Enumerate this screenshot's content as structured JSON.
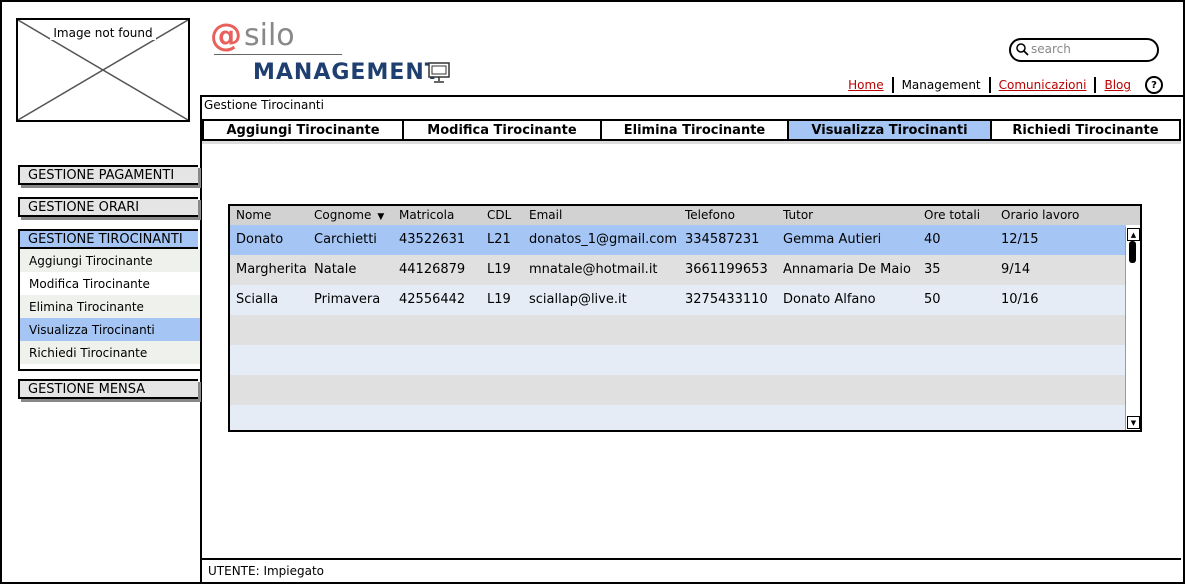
{
  "image_placeholder": {
    "label": "Image not found"
  },
  "logo": {
    "at": "@",
    "name": "silo",
    "subtitle": "MANAGEMENT"
  },
  "search": {
    "placeholder": "search"
  },
  "topnav": {
    "home": "Home",
    "management": "Management",
    "comunicazioni": "Comunicazioni",
    "blog": "Blog",
    "help": "?"
  },
  "breadcrumb": "Gestione Tirocinanti",
  "tabs": [
    "Aggiungi Tirocinante",
    "Modifica Tirocinante",
    "Elimina Tirocinante",
    "Visualizza Tirocinanti",
    "Richiedi Tirocinante"
  ],
  "active_tab": "Visualizza Tirocinanti",
  "sidebar": {
    "pagamenti": "GESTIONE PAGAMENTI",
    "orari": "GESTIONE ORARI",
    "tirocinanti": "GESTIONE TIROCINANTI",
    "items": [
      "Aggiungi Tirocinante",
      "Modifica Tirocinante",
      "Elimina Tirocinante",
      "Visualizza Tirocinanti",
      "Richiedi Tirocinante"
    ],
    "mensa": "GESTIONE MENSA"
  },
  "table": {
    "columns": [
      "Nome",
      "Cognome",
      "Matricola",
      "CDL",
      "Email",
      "Telefono",
      "Tutor",
      "Ore totali",
      "Orario lavoro"
    ],
    "sort_icon": "▼",
    "rows": [
      [
        "Donato",
        "Carchietti",
        "43522631",
        "L21",
        "donatos_1@gmail.com",
        "334587231",
        "Gemma Autieri",
        "40",
        "12/15"
      ],
      [
        "Margherita",
        "Natale",
        "44126879",
        "L19",
        "mnatale@hotmail.it",
        "3661199653",
        "Annamaria De Maio",
        "35",
        "9/14"
      ],
      [
        "Scialla",
        "Primavera",
        "42556442",
        "L19",
        "sciallap@live.it",
        "3275433110",
        "Donato Alfano",
        "50",
        "10/16"
      ]
    ]
  },
  "footer": "UTENTE: Impiegato",
  "colors": {
    "accent": "#a5c6f4",
    "brand": "#1e3f6f",
    "logo_at": "#e8605c",
    "link": "#bb0000"
  }
}
